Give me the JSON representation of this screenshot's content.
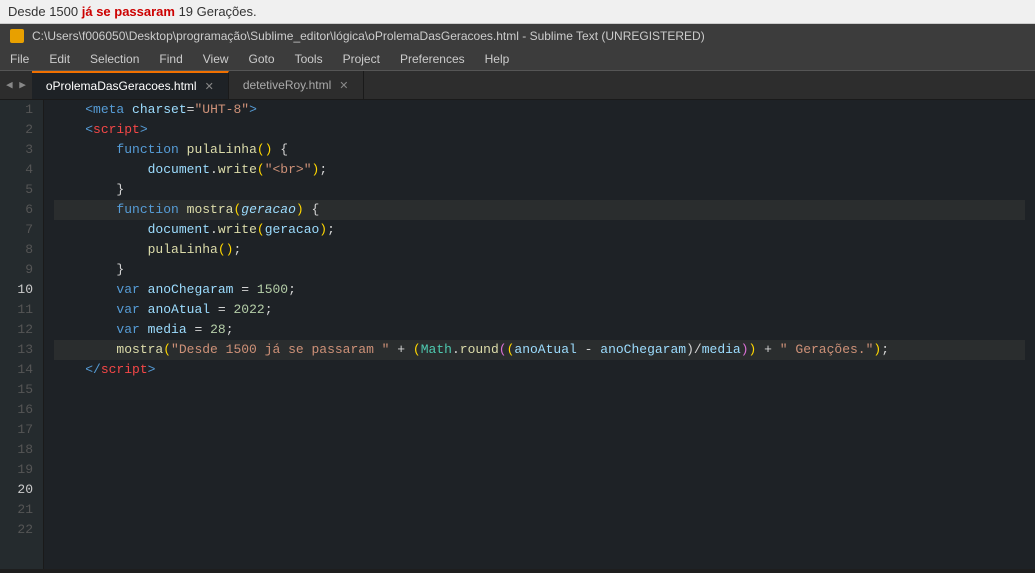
{
  "output": {
    "text": "Desde 1500 já se passaram 19 Gerações.",
    "highlight_start": 11,
    "highlight_end": 35
  },
  "titlebar": {
    "path": "C:\\Users\\f006050\\Desktop\\programação\\Sublime_editor\\lógica\\oProlemaDasGeracoes.html - Sublime Text (UNREGISTERED)"
  },
  "menu": {
    "items": [
      "File",
      "Edit",
      "Selection",
      "Find",
      "View",
      "Goto",
      "Tools",
      "Project",
      "Preferences",
      "Help"
    ]
  },
  "tabs": [
    {
      "label": "oProlemaDasGeracoes.html",
      "active": true
    },
    {
      "label": "detetiveRoy.html",
      "active": false
    }
  ],
  "lines": [
    {
      "num": 1
    },
    {
      "num": 2
    },
    {
      "num": 3
    },
    {
      "num": 4
    },
    {
      "num": 5
    },
    {
      "num": 6
    },
    {
      "num": 7
    },
    {
      "num": 8
    },
    {
      "num": 9
    },
    {
      "num": 10
    },
    {
      "num": 11
    },
    {
      "num": 12
    },
    {
      "num": 13
    },
    {
      "num": 14
    },
    {
      "num": 15
    },
    {
      "num": 16
    },
    {
      "num": 17
    },
    {
      "num": 18
    },
    {
      "num": 19
    },
    {
      "num": 20
    },
    {
      "num": 21
    },
    {
      "num": 22
    }
  ]
}
